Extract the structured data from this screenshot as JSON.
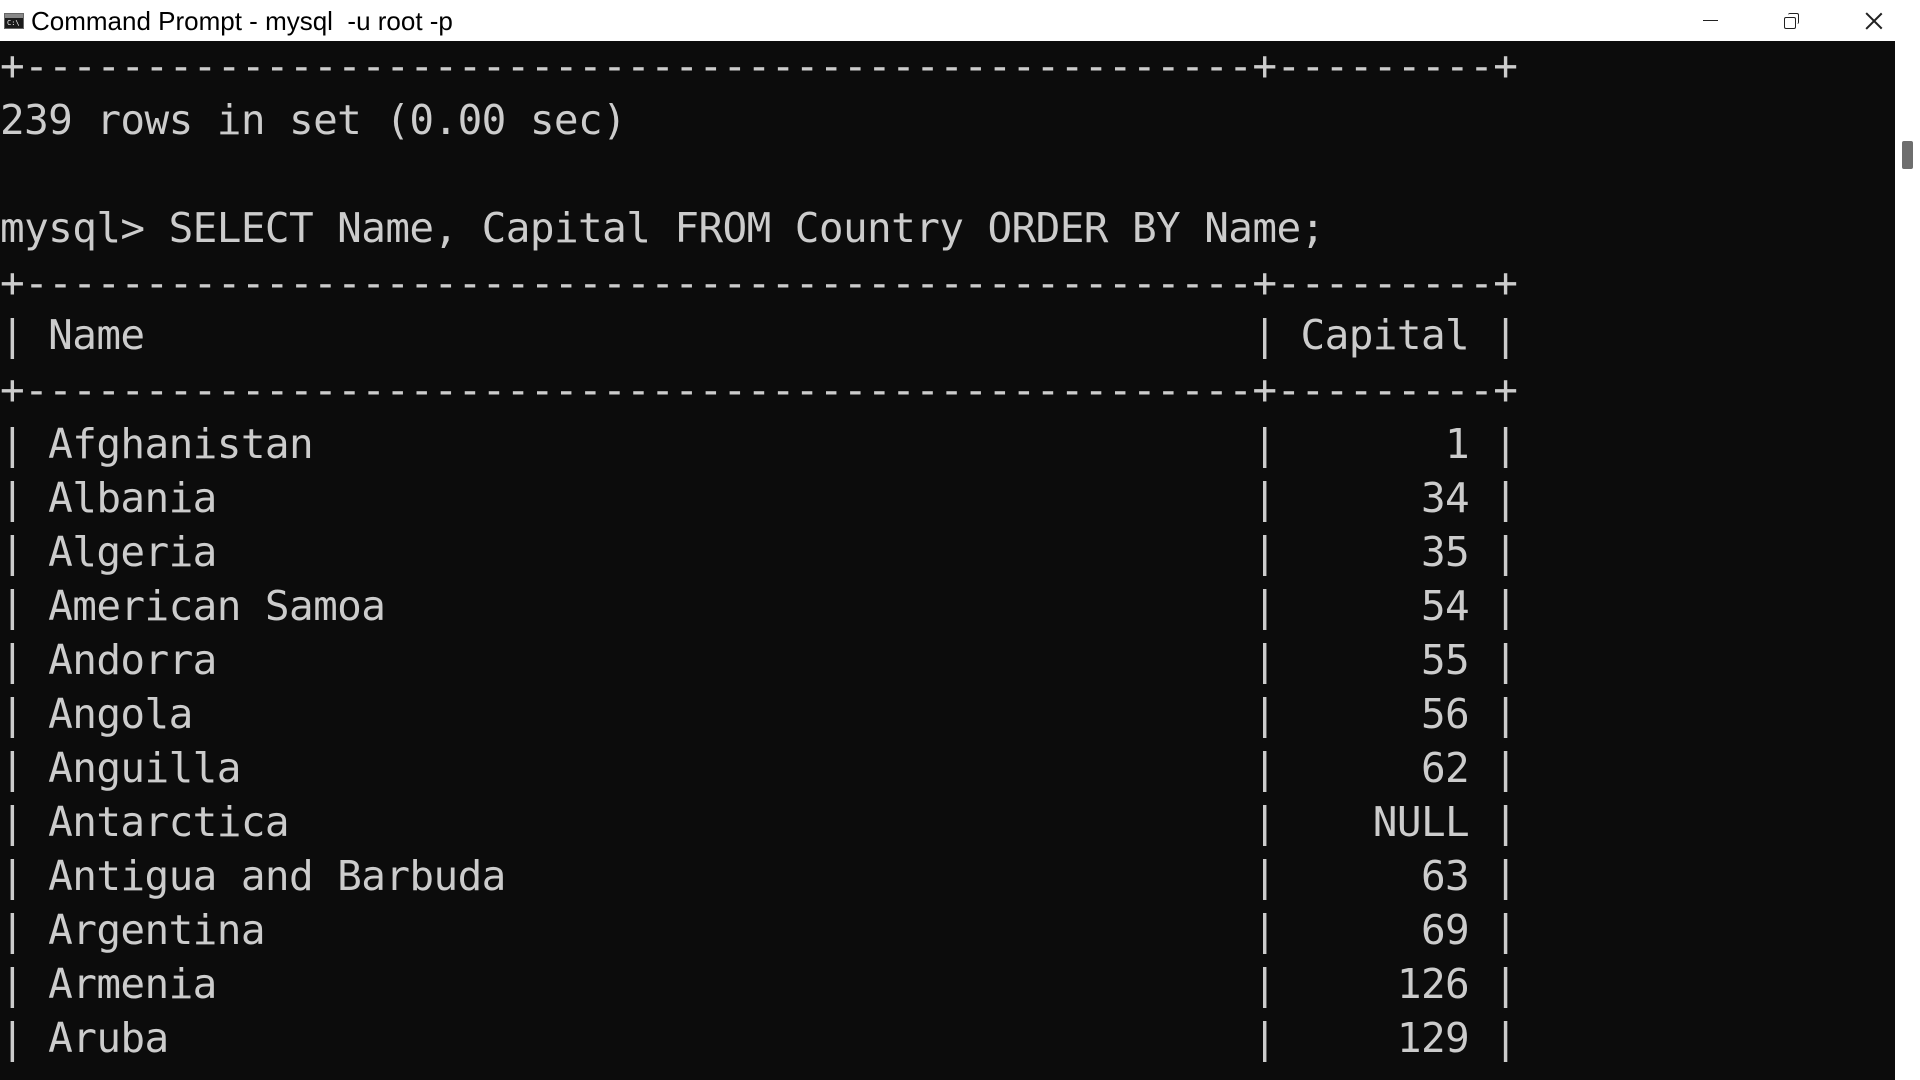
{
  "window": {
    "title": "Command Prompt - mysql  -u root -p",
    "app_icon_text": "C:\\",
    "minimize_icon": "minimize-icon",
    "maximize_icon": "restore-icon",
    "close_icon": "close-icon"
  },
  "terminal": {
    "border_top": "+---------------------------------------------------+---------+",
    "result_summary": "239 rows in set (0.00 sec)",
    "blank": "",
    "prompt": "mysql> ",
    "command": "SELECT Name, Capital FROM Country ORDER BY Name;",
    "table_border": "+---------------------------------------------------+---------+",
    "header_row": "| Name                                              | Capital |",
    "header_border": "+---------------------------------------------------+---------+",
    "columns": [
      "Name",
      "Capital"
    ],
    "rows": [
      {
        "name": "Afghanistan",
        "capital": "1"
      },
      {
        "name": "Albania",
        "capital": "34"
      },
      {
        "name": "Algeria",
        "capital": "35"
      },
      {
        "name": "American Samoa",
        "capital": "54"
      },
      {
        "name": "Andorra",
        "capital": "55"
      },
      {
        "name": "Angola",
        "capital": "56"
      },
      {
        "name": "Anguilla",
        "capital": "62"
      },
      {
        "name": "Antarctica",
        "capital": "NULL"
      },
      {
        "name": "Antigua and Barbuda",
        "capital": "63"
      },
      {
        "name": "Argentina",
        "capital": "69"
      },
      {
        "name": "Armenia",
        "capital": "126"
      },
      {
        "name": "Aruba",
        "capital": "129"
      }
    ]
  },
  "colors": {
    "terminal_bg": "#0c0c0c",
    "terminal_fg": "#cccccc",
    "titlebar_bg": "#ffffff"
  }
}
